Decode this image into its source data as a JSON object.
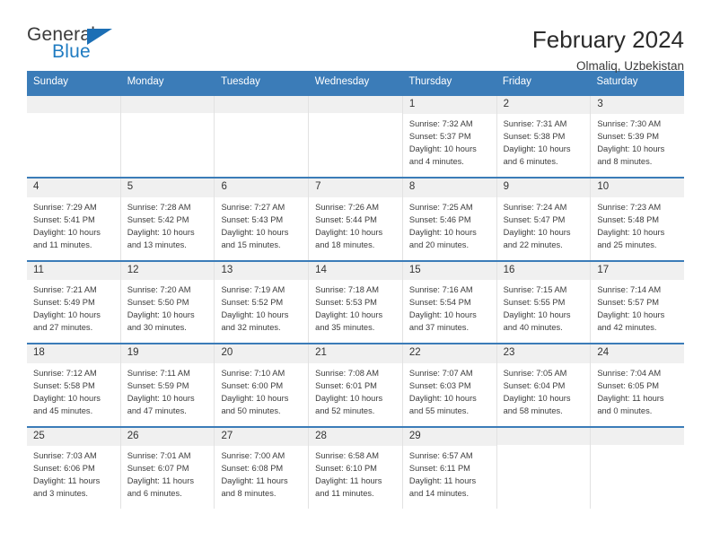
{
  "brand": {
    "name_part1": "General",
    "name_part2": "Blue",
    "accent_color": "#1c6fb5"
  },
  "header": {
    "title": "February 2024",
    "location": "Olmaliq, Uzbekistan"
  },
  "calendar": {
    "header_bg": "#3b7cb8",
    "weekdays": [
      "Sunday",
      "Monday",
      "Tuesday",
      "Wednesday",
      "Thursday",
      "Friday",
      "Saturday"
    ],
    "weeks": [
      [
        {
          "blank": true
        },
        {
          "blank": true
        },
        {
          "blank": true
        },
        {
          "blank": true
        },
        {
          "day": "1",
          "sunrise": "Sunrise: 7:32 AM",
          "sunset": "Sunset: 5:37 PM",
          "daylight1": "Daylight: 10 hours",
          "daylight2": "and 4 minutes."
        },
        {
          "day": "2",
          "sunrise": "Sunrise: 7:31 AM",
          "sunset": "Sunset: 5:38 PM",
          "daylight1": "Daylight: 10 hours",
          "daylight2": "and 6 minutes."
        },
        {
          "day": "3",
          "sunrise": "Sunrise: 7:30 AM",
          "sunset": "Sunset: 5:39 PM",
          "daylight1": "Daylight: 10 hours",
          "daylight2": "and 8 minutes."
        }
      ],
      [
        {
          "day": "4",
          "sunrise": "Sunrise: 7:29 AM",
          "sunset": "Sunset: 5:41 PM",
          "daylight1": "Daylight: 10 hours",
          "daylight2": "and 11 minutes."
        },
        {
          "day": "5",
          "sunrise": "Sunrise: 7:28 AM",
          "sunset": "Sunset: 5:42 PM",
          "daylight1": "Daylight: 10 hours",
          "daylight2": "and 13 minutes."
        },
        {
          "day": "6",
          "sunrise": "Sunrise: 7:27 AM",
          "sunset": "Sunset: 5:43 PM",
          "daylight1": "Daylight: 10 hours",
          "daylight2": "and 15 minutes."
        },
        {
          "day": "7",
          "sunrise": "Sunrise: 7:26 AM",
          "sunset": "Sunset: 5:44 PM",
          "daylight1": "Daylight: 10 hours",
          "daylight2": "and 18 minutes."
        },
        {
          "day": "8",
          "sunrise": "Sunrise: 7:25 AM",
          "sunset": "Sunset: 5:46 PM",
          "daylight1": "Daylight: 10 hours",
          "daylight2": "and 20 minutes."
        },
        {
          "day": "9",
          "sunrise": "Sunrise: 7:24 AM",
          "sunset": "Sunset: 5:47 PM",
          "daylight1": "Daylight: 10 hours",
          "daylight2": "and 22 minutes."
        },
        {
          "day": "10",
          "sunrise": "Sunrise: 7:23 AM",
          "sunset": "Sunset: 5:48 PM",
          "daylight1": "Daylight: 10 hours",
          "daylight2": "and 25 minutes."
        }
      ],
      [
        {
          "day": "11",
          "sunrise": "Sunrise: 7:21 AM",
          "sunset": "Sunset: 5:49 PM",
          "daylight1": "Daylight: 10 hours",
          "daylight2": "and 27 minutes."
        },
        {
          "day": "12",
          "sunrise": "Sunrise: 7:20 AM",
          "sunset": "Sunset: 5:50 PM",
          "daylight1": "Daylight: 10 hours",
          "daylight2": "and 30 minutes."
        },
        {
          "day": "13",
          "sunrise": "Sunrise: 7:19 AM",
          "sunset": "Sunset: 5:52 PM",
          "daylight1": "Daylight: 10 hours",
          "daylight2": "and 32 minutes."
        },
        {
          "day": "14",
          "sunrise": "Sunrise: 7:18 AM",
          "sunset": "Sunset: 5:53 PM",
          "daylight1": "Daylight: 10 hours",
          "daylight2": "and 35 minutes."
        },
        {
          "day": "15",
          "sunrise": "Sunrise: 7:16 AM",
          "sunset": "Sunset: 5:54 PM",
          "daylight1": "Daylight: 10 hours",
          "daylight2": "and 37 minutes."
        },
        {
          "day": "16",
          "sunrise": "Sunrise: 7:15 AM",
          "sunset": "Sunset: 5:55 PM",
          "daylight1": "Daylight: 10 hours",
          "daylight2": "and 40 minutes."
        },
        {
          "day": "17",
          "sunrise": "Sunrise: 7:14 AM",
          "sunset": "Sunset: 5:57 PM",
          "daylight1": "Daylight: 10 hours",
          "daylight2": "and 42 minutes."
        }
      ],
      [
        {
          "day": "18",
          "sunrise": "Sunrise: 7:12 AM",
          "sunset": "Sunset: 5:58 PM",
          "daylight1": "Daylight: 10 hours",
          "daylight2": "and 45 minutes."
        },
        {
          "day": "19",
          "sunrise": "Sunrise: 7:11 AM",
          "sunset": "Sunset: 5:59 PM",
          "daylight1": "Daylight: 10 hours",
          "daylight2": "and 47 minutes."
        },
        {
          "day": "20",
          "sunrise": "Sunrise: 7:10 AM",
          "sunset": "Sunset: 6:00 PM",
          "daylight1": "Daylight: 10 hours",
          "daylight2": "and 50 minutes."
        },
        {
          "day": "21",
          "sunrise": "Sunrise: 7:08 AM",
          "sunset": "Sunset: 6:01 PM",
          "daylight1": "Daylight: 10 hours",
          "daylight2": "and 52 minutes."
        },
        {
          "day": "22",
          "sunrise": "Sunrise: 7:07 AM",
          "sunset": "Sunset: 6:03 PM",
          "daylight1": "Daylight: 10 hours",
          "daylight2": "and 55 minutes."
        },
        {
          "day": "23",
          "sunrise": "Sunrise: 7:05 AM",
          "sunset": "Sunset: 6:04 PM",
          "daylight1": "Daylight: 10 hours",
          "daylight2": "and 58 minutes."
        },
        {
          "day": "24",
          "sunrise": "Sunrise: 7:04 AM",
          "sunset": "Sunset: 6:05 PM",
          "daylight1": "Daylight: 11 hours",
          "daylight2": "and 0 minutes."
        }
      ],
      [
        {
          "day": "25",
          "sunrise": "Sunrise: 7:03 AM",
          "sunset": "Sunset: 6:06 PM",
          "daylight1": "Daylight: 11 hours",
          "daylight2": "and 3 minutes."
        },
        {
          "day": "26",
          "sunrise": "Sunrise: 7:01 AM",
          "sunset": "Sunset: 6:07 PM",
          "daylight1": "Daylight: 11 hours",
          "daylight2": "and 6 minutes."
        },
        {
          "day": "27",
          "sunrise": "Sunrise: 7:00 AM",
          "sunset": "Sunset: 6:08 PM",
          "daylight1": "Daylight: 11 hours",
          "daylight2": "and 8 minutes."
        },
        {
          "day": "28",
          "sunrise": "Sunrise: 6:58 AM",
          "sunset": "Sunset: 6:10 PM",
          "daylight1": "Daylight: 11 hours",
          "daylight2": "and 11 minutes."
        },
        {
          "day": "29",
          "sunrise": "Sunrise: 6:57 AM",
          "sunset": "Sunset: 6:11 PM",
          "daylight1": "Daylight: 11 hours",
          "daylight2": "and 14 minutes."
        },
        {
          "blank": true
        },
        {
          "blank": true
        }
      ]
    ]
  }
}
